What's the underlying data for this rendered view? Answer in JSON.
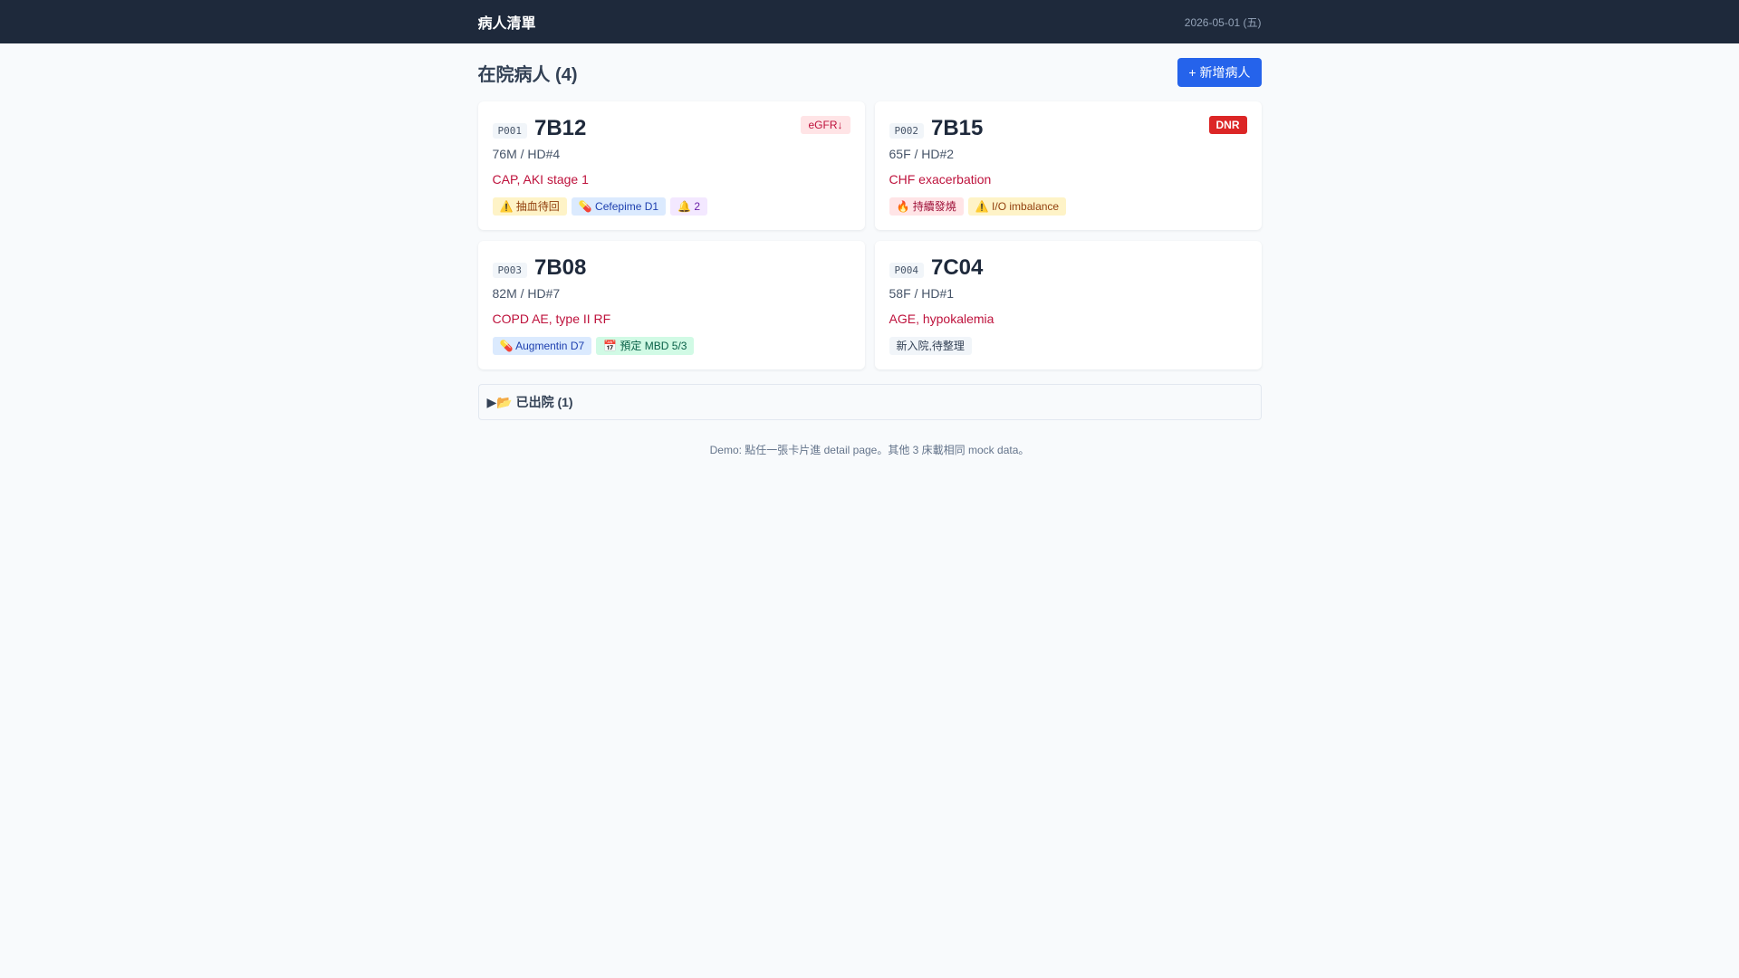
{
  "app": {
    "title": "病人清單",
    "date": "2026-05-01 (五)"
  },
  "header": {
    "title": "在院病人 (4)",
    "add_label": "+ 新增病人"
  },
  "patients": [
    {
      "id": "P001",
      "bed": "7B12",
      "demo": "76M / HD#4",
      "diagnosis": "CAP, AKI stage 1",
      "badge": "eGFR↓",
      "tags": [
        "⚠️ 抽血待回",
        "💊 Cefepime D1",
        "🔔 2"
      ]
    },
    {
      "id": "P002",
      "bed": "7B15",
      "demo": "65F / HD#2",
      "diagnosis": "CHF exacerbation",
      "badge": "DNR",
      "tags": [
        "🔥 持續發燒",
        "⚠️ I/O imbalance"
      ]
    },
    {
      "id": "P003",
      "bed": "7B08",
      "demo": "82M / HD#7",
      "diagnosis": "COPD AE, type II RF",
      "tags": [
        "💊 Augmentin D7",
        "📅 預定 MBD 5/3"
      ]
    },
    {
      "id": "P004",
      "bed": "7C04",
      "demo": "58F / HD#1",
      "diagnosis": "AGE, hypokalemia",
      "tags": [
        "新入院,待整理"
      ]
    }
  ],
  "discharged": {
    "label": "▶📂 已出院 (1)"
  },
  "footer": {
    "note": "Demo: 點任一張卡片進 detail page。其他 3 床載相同 mock data。"
  },
  "colors": {
    "accent": "#2563eb",
    "topbar": "#1e293b",
    "danger": "#dc2626",
    "diagnosis": "#be123c"
  }
}
